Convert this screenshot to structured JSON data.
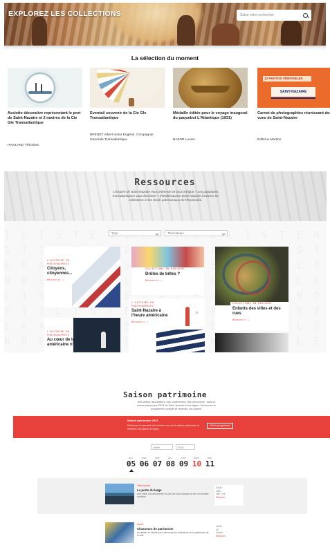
{
  "hero": {
    "title": "Explorez les collections",
    "search_placeholder": "Saisir votre recherche"
  },
  "selection": {
    "title": "La sélection du moment",
    "items": [
      {
        "title": "Assiette décorative représentant le port de Saint-Nazaire et 2 navires de la Cie Gle Transatlantique",
        "author": "HAVILAND Théodore"
      },
      {
        "title": "Eventail souvenir de la Cie Gle Transatlantique",
        "author": "BRENET Albert Victor Eugène, Compagnie Générale Transatlantique"
      },
      {
        "title": "Médaille éditée pour le voyage inaugural du paquebot L'Atlantique (1931)",
        "author": "BAZOR Lucien"
      },
      {
        "title": "Carnet de photographies réunissant des vues de Saint-Nazaire",
        "author": "Éditions Martine",
        "cover_strip": "12 PHOTOS VÉRITABLES",
        "cover_title": "SAINT-NAZAIRE"
      }
    ]
  },
  "ressources": {
    "title": "Ressources",
    "description": "L'histoire de Saint-Nazaire vous intéresse et vous intrigue ? Les paquebots transatlantiques vous fascinent ? (Re)découvrez Saint-Nazaire à travers les collections et les fonds patrimoniaux de l'Écomusée.",
    "filter_type": "Type",
    "filter_thematique": "Thématique",
    "tiles": [
      {
        "tag": "L'histoire en photographies",
        "title": "Citoyens, citoyennes...",
        "link": "Découvrir →"
      },
      {
        "tag": "Collections en dialogue",
        "title": "Drôles de bêtes ?",
        "link": "Découvrir →"
      },
      {
        "tag": "Collections en dialogue",
        "title": "Enfants des villes et des rues",
        "link": "Découvrir →"
      },
      {
        "tag": "L'histoire en photographies",
        "title": "Saint-Nazaire à l'heure américaine",
        "link": "Découvrir →"
      },
      {
        "tag": "L'histoire en photographies",
        "title": "Au cœur de la base américaine n°1",
        "link": ""
      }
    ]
  },
  "saison": {
    "title": "Saison patrimoine",
    "description": "Des visites, des ateliers, des conférences, des rencontres : toute la saison patrimoine 2021 de Saint-Nazaire et sa région. Découvrez le programme complet et réservez vos places.",
    "banner_kicker": "Saison patrimoine 2021",
    "banner_desc": "Retrouvez l'ensemble des rendez-vous de la saison patrimoine et réservez vos places en ligne.",
    "banner_button": "Voir le programme",
    "month_select": "Juillet",
    "year_select": "2021",
    "days": [
      {
        "name": "lun.",
        "num": "05"
      },
      {
        "name": "mar.",
        "num": "06"
      },
      {
        "name": "mer.",
        "num": "07"
      },
      {
        "name": "jeu.",
        "num": "08"
      },
      {
        "name": "ven.",
        "num": "09"
      },
      {
        "name": "sam.",
        "num": "10"
      },
      {
        "name": "dim.",
        "num": "11"
      }
    ],
    "events": [
      {
        "kicker": "Visite guidée",
        "name": "La porte du large",
        "desc": "Une visite à la découverte du port de Saint-Nazaire et de son histoire maritime.",
        "info": [
          "10h30",
          "1h30",
          "Tarif : 5 €",
          "Réserver"
        ]
      },
      {
        "kicker": "Atelier",
        "name": "Chasseurs de patrimoine",
        "desc": "Un atelier en famille pour découvrir les collections et le patrimoine de la ville.",
        "info": [
          "14h00",
          "2h",
          "Gratuit",
          "Réserver"
        ]
      }
    ]
  },
  "colors": {
    "accent": "#e8403a",
    "brand_orange": "#ea6b2c"
  }
}
